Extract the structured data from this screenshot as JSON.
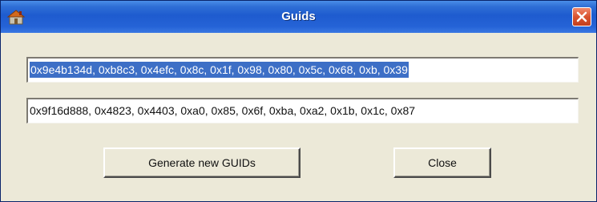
{
  "window": {
    "title": "Guids"
  },
  "fields": {
    "guid1": "0x9e4b134d, 0xb8c3, 0x4efc, 0x8c, 0x1f, 0x98, 0x80, 0x5c, 0x68, 0xb, 0x39",
    "guid2": "0x9f16d888, 0x4823, 0x4403, 0xa0, 0x85, 0x6f, 0xba, 0xa2, 0x1b, 0x1c, 0x87"
  },
  "buttons": {
    "generate_label": "Generate new GUIDs",
    "close_label": "Close"
  },
  "colors": {
    "titlebar": "#1e5bcf",
    "selection": "#3d6fc6",
    "close_button": "#d9532f",
    "dialog_face": "#ece9d8"
  },
  "icons": {
    "app": "app-icon",
    "close": "close-icon"
  }
}
